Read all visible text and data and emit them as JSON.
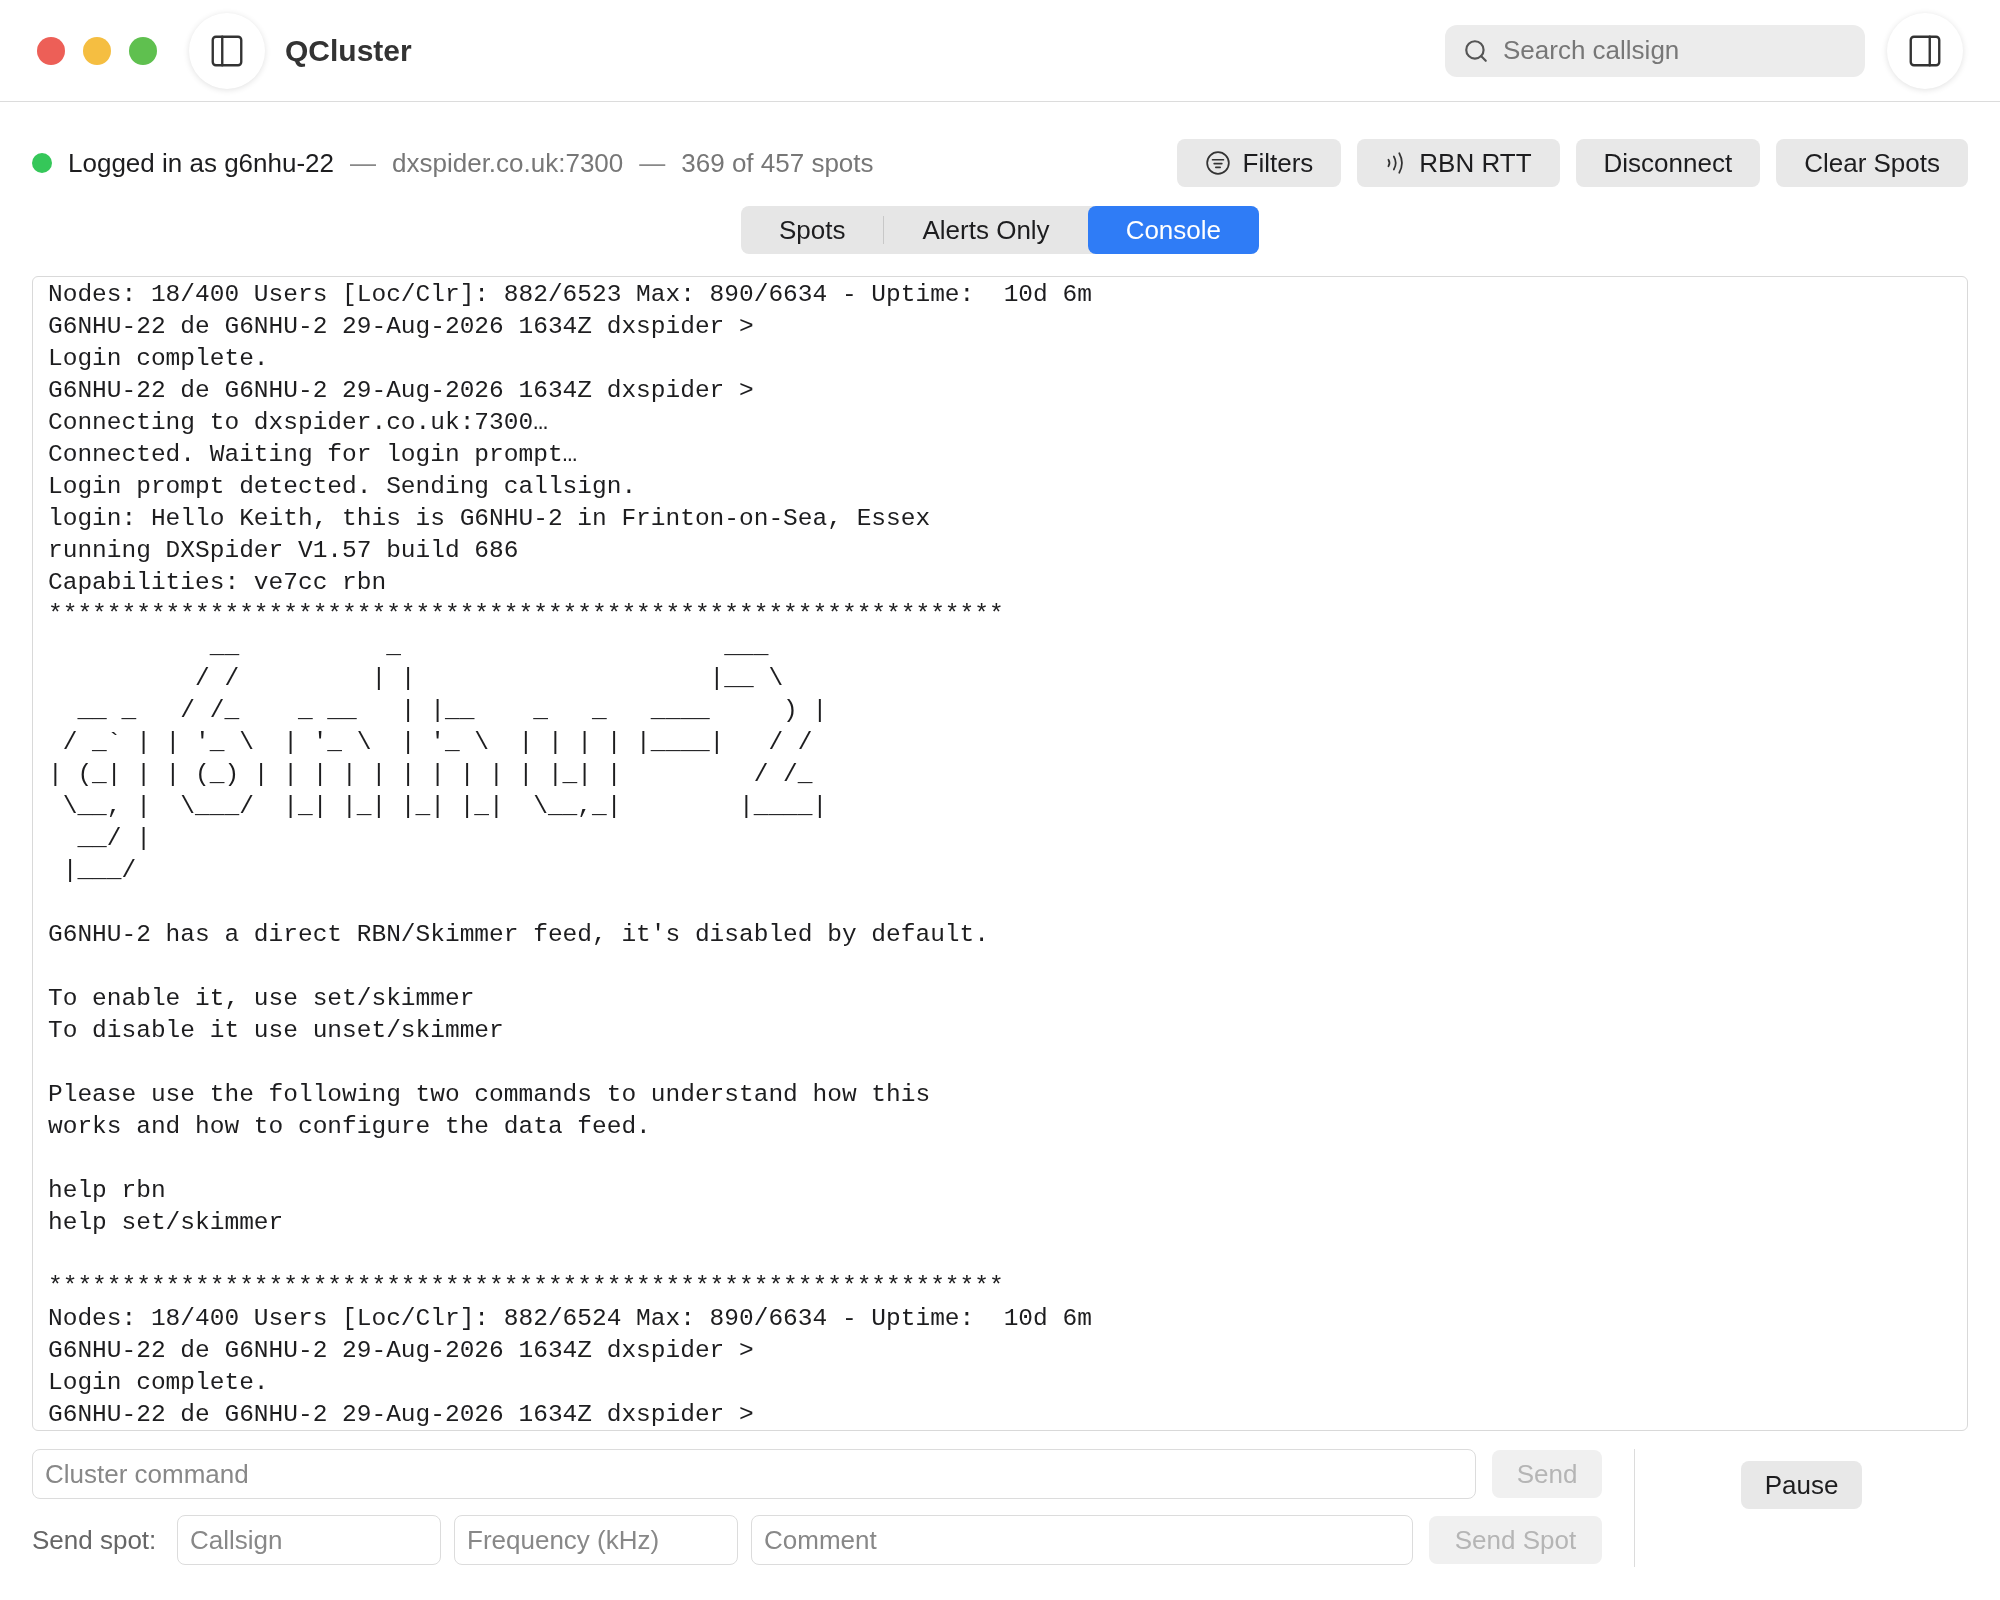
{
  "window": {
    "title": "QCluster"
  },
  "search": {
    "placeholder": "Search callsign"
  },
  "status": {
    "connected": true,
    "login": "Logged in as g6nhu-22",
    "separator_1": "—",
    "server": "dxspider.co.uk:7300",
    "separator_2": "—",
    "spots": "369 of 457 spots"
  },
  "toolbar_buttons": [
    {
      "label": "Filters",
      "kind": "filter"
    },
    {
      "label": "RBN RTT",
      "kind": "radio"
    },
    {
      "label": "Disconnect",
      "kind": "plain"
    },
    {
      "label": "Clear Spots",
      "kind": "plain"
    }
  ],
  "tabs": [
    {
      "label": "Spots",
      "selected": false
    },
    {
      "label": "Alerts Only",
      "selected": false
    },
    {
      "label": "Console",
      "selected": true
    }
  ],
  "console": {
    "paragraphs": [
      [
        "Nodes: 18/400 Users [Loc/Clr]: 882/6523 Max: 890/6634 - Uptime:  10d 6m",
        "G6NHU-22 de G6NHU-2 29-Aug-2026 1634Z dxspider >",
        "Login complete.",
        "G6NHU-22 de G6NHU-2 29-Aug-2026 1634Z dxspider >",
        "Connecting to dxspider.co.uk:7300…",
        "Connected. Waiting for login prompt…",
        "Login prompt detected. Sending callsign.",
        "login: Hello Keith, this is G6NHU-2 in Frinton-on-Sea, Essex",
        "running DXSpider V1.57 build 686",
        "Capabilities: ve7cc rbn",
        "*****************************************************************",
        "           __          _                      ___",
        "          / /         | |                    |__ \\",
        "  __ _   / /_    _ __   | |__    _   _   ____     ) |",
        " / _` | | '_ \\  | '_ \\  | '_ \\  | | | | |____|   / /",
        "| (_| | | (_) | | | | | | | | | | |_| |         / /_",
        " \\__, |  \\___/  |_| |_| |_| |_|  \\__,_|        |____|",
        "  __/ |",
        " |___/"
      ],
      [
        "G6NHU-2 has a direct RBN/Skimmer feed, it's disabled by default."
      ],
      [
        "To enable it, use set/skimmer",
        "To disable it use unset/skimmer"
      ],
      [
        "Please use the following two commands to understand how this",
        "works and how to configure the data feed."
      ],
      [
        "help rbn",
        "help set/skimmer"
      ],
      [
        "*****************************************************************",
        "Nodes: 18/400 Users [Loc/Clr]: 882/6524 Max: 890/6634 - Uptime:  10d 6m",
        "G6NHU-22 de G6NHU-2 29-Aug-2026 1634Z dxspider >",
        "Login complete.",
        "G6NHU-22 de G6NHU-2 29-Aug-2026 1634Z dxspider >"
      ]
    ]
  },
  "command": {
    "placeholder": "Cluster command",
    "send": {
      "label": "Send",
      "disabled": true
    }
  },
  "pause": {
    "label": "Pause"
  },
  "spot_form": {
    "label": "Send spot:",
    "callsign_placeholder": "Callsign",
    "frequency_placeholder": "Frequency (kHz)",
    "comment_placeholder": "Comment",
    "send": {
      "label": "Send Spot",
      "disabled": true
    }
  }
}
